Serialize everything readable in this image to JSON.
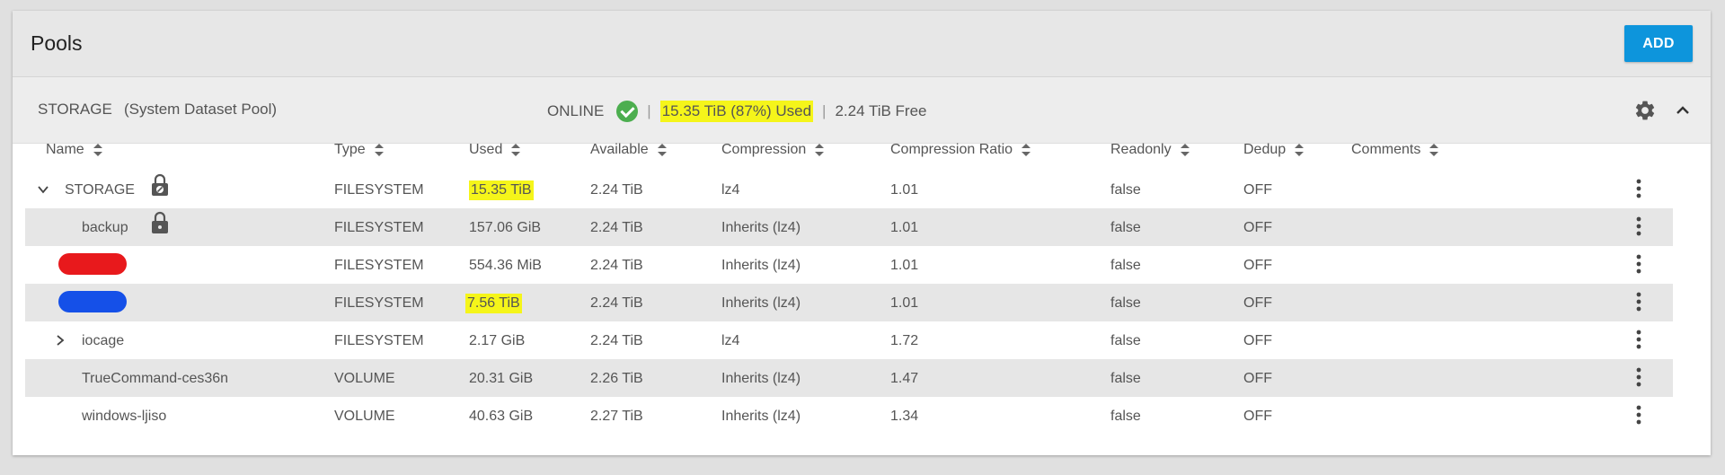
{
  "header": {
    "title": "Pools",
    "add_label": "ADD"
  },
  "pool": {
    "name": "STORAGE",
    "description": "(System Dataset Pool)",
    "status": "ONLINE",
    "used_text": "15.35 TiB (87%) Used",
    "free_text": "2.24 TiB Free",
    "separator": "|"
  },
  "colors": {
    "accent": "#0d95dc",
    "status_ok": "#4cae4f",
    "highlight": "#f5f51a",
    "redact_red": "#e8191c",
    "redact_blue": "#1550e8"
  },
  "table": {
    "columns": [
      "Name",
      "Type",
      "Used",
      "Available",
      "Compression",
      "Compression Ratio",
      "Readonly",
      "Dedup",
      "Comments"
    ],
    "rows": [
      {
        "name": "STORAGE",
        "type": "FILESYSTEM",
        "used": "15.35 TiB",
        "available": "2.24 TiB",
        "compression": "lz4",
        "ratio": "1.01",
        "readonly": "false",
        "dedup": "OFF",
        "comments": ""
      },
      {
        "name": "backup",
        "type": "FILESYSTEM",
        "used": "157.06 GiB",
        "available": "2.24 TiB",
        "compression": "Inherits (lz4)",
        "ratio": "1.01",
        "readonly": "false",
        "dedup": "OFF",
        "comments": ""
      },
      {
        "name": "",
        "type": "FILESYSTEM",
        "used": "554.36 MiB",
        "available": "2.24 TiB",
        "compression": "Inherits (lz4)",
        "ratio": "1.01",
        "readonly": "false",
        "dedup": "OFF",
        "comments": ""
      },
      {
        "name": "",
        "type": "FILESYSTEM",
        "used": "7.56 TiB",
        "available": "2.24 TiB",
        "compression": "Inherits (lz4)",
        "ratio": "1.01",
        "readonly": "false",
        "dedup": "OFF",
        "comments": ""
      },
      {
        "name": "iocage",
        "type": "FILESYSTEM",
        "used": "2.17 GiB",
        "available": "2.24 TiB",
        "compression": "lz4",
        "ratio": "1.72",
        "readonly": "false",
        "dedup": "OFF",
        "comments": ""
      },
      {
        "name": "TrueCommand-ces36n",
        "type": "VOLUME",
        "used": "20.31 GiB",
        "available": "2.26 TiB",
        "compression": "Inherits (lz4)",
        "ratio": "1.47",
        "readonly": "false",
        "dedup": "OFF",
        "comments": ""
      },
      {
        "name": "windows-ljiso",
        "type": "VOLUME",
        "used": "40.63 GiB",
        "available": "2.27 TiB",
        "compression": "Inherits (lz4)",
        "ratio": "1.34",
        "readonly": "false",
        "dedup": "OFF",
        "comments": ""
      }
    ]
  },
  "icons": {
    "status": "check-circle-icon",
    "settings": "gear-icon",
    "collapse": "chevron-up-icon",
    "row_menu": "kebab-icon",
    "lock": "lock-icon",
    "expand": "chevron-icon"
  }
}
